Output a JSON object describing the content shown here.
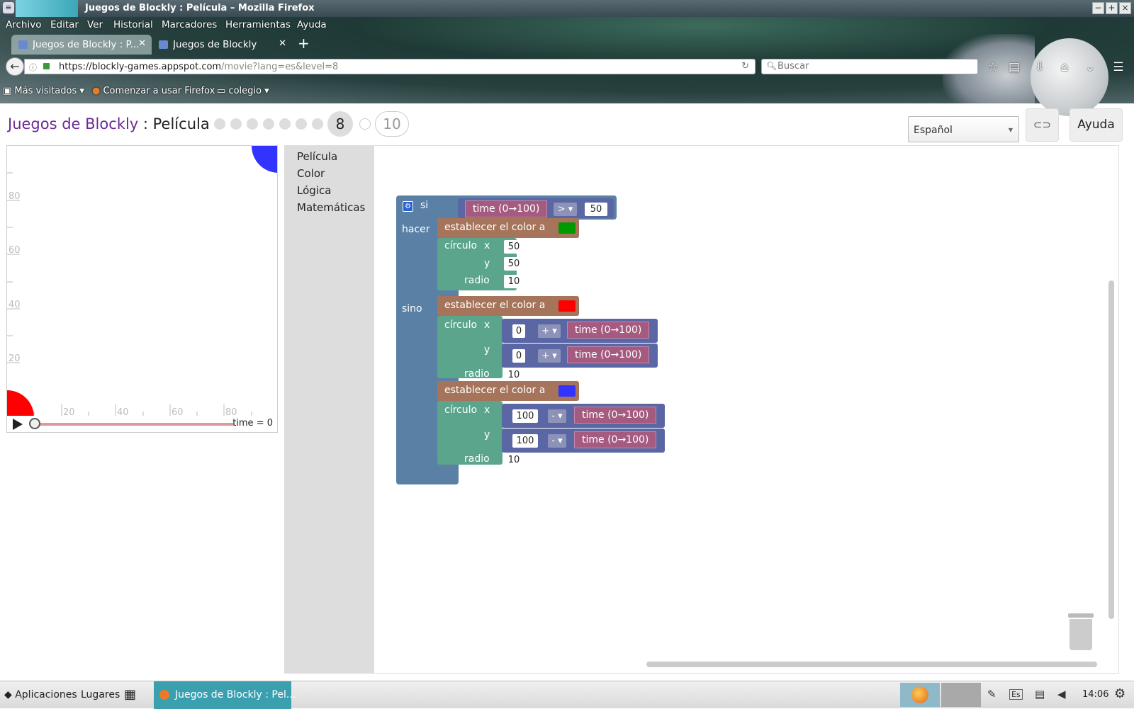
{
  "window": {
    "title": "Juegos de Blockly : Película – Mozilla Firefox",
    "minimize": "−",
    "maximize": "+",
    "close": "×"
  },
  "menu": [
    "Archivo",
    "Editar",
    "Ver",
    "Historial",
    "Marcadores",
    "Herramientas",
    "Ayuda"
  ],
  "tabs": [
    {
      "label": "Juegos de Blockly : P...",
      "active": true
    },
    {
      "label": "Juegos de Blockly",
      "active": false
    }
  ],
  "new_tab": "+",
  "nav": {
    "url_host": "https://blockly-games.appspot.com",
    "url_path": "/movie?lang=es&level=8",
    "search_placeholder": "Buscar"
  },
  "bookmarks": [
    "Más visitados",
    "Comenzar a usar Firefox",
    "colegio"
  ],
  "header": {
    "game": "Juegos de Blockly",
    "separator": " : ",
    "page": "Película",
    "current_level": "8",
    "last_level": "10",
    "language": "Español",
    "help": "Ayuda"
  },
  "preview": {
    "y_ticks": [
      "80",
      "60",
      "40",
      "20"
    ],
    "x_ticks": [
      "20",
      "40",
      "60",
      "80"
    ],
    "time_label": "time = 0",
    "time_progress": 0
  },
  "toolbox": [
    "Película",
    "Color",
    "Lógica",
    "Matemáticas"
  ],
  "blocks": {
    "if_label": "si",
    "do_label": "hacer",
    "else_label": "sino",
    "time_label": "time (0→100)",
    "compare_op": ">",
    "compare_value": "50",
    "set_color_label": "establecer el color a",
    "circle_label": "círculo",
    "x_label": "x",
    "y_label": "y",
    "radius_label": "radio",
    "do_circle": {
      "x": "50",
      "y": "50",
      "radius": "10",
      "color": "#009900"
    },
    "else_circle_1": {
      "x_num": "0",
      "x_op": "+",
      "y_num": "0",
      "y_op": "+",
      "radius": "10",
      "color": "#ff0000"
    },
    "else_circle_2": {
      "x_num": "100",
      "x_op": "-",
      "y_num": "100",
      "y_op": "-",
      "radius": "10",
      "color": "#3333ff"
    }
  },
  "taskbar": {
    "apps": "Aplicaciones",
    "places": "Lugares",
    "window": "Juegos de Blockly : Pel...",
    "keyboard": "Es",
    "clock": "14:06"
  },
  "colors": {
    "if_block": "#5b80a5",
    "set_color_block": "#a5745b",
    "circle_block": "#5ba58c",
    "time_block": "#a55b80",
    "math_block": "#5b67a5",
    "title_accent": "#6a2a96"
  }
}
